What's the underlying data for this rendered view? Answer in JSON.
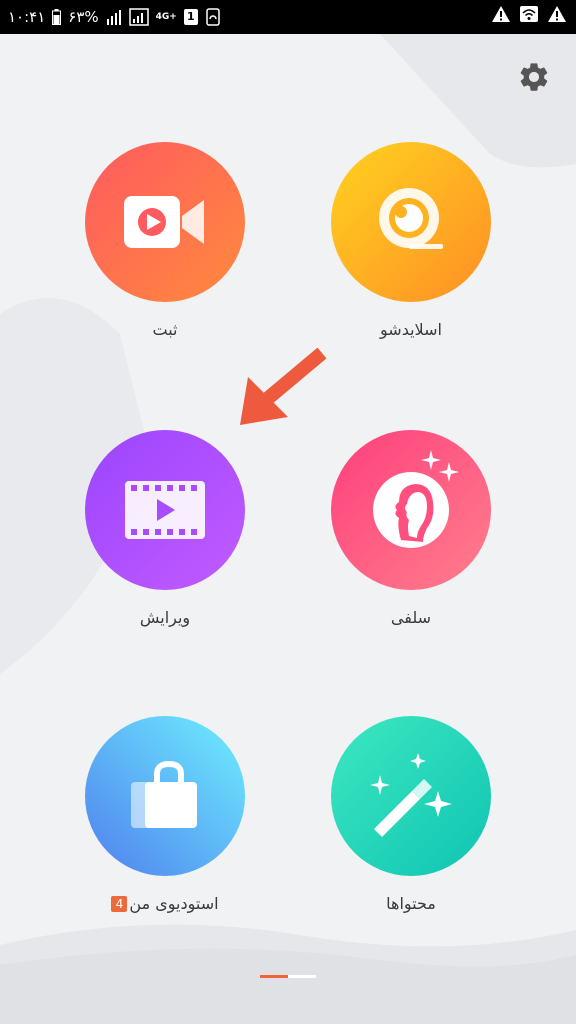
{
  "status_bar": {
    "time": "۱۰:۴۱",
    "battery": "۶۳%",
    "network": "4G+",
    "sim_slot": "1"
  },
  "tiles": [
    {
      "id": "record",
      "label": "ثبت",
      "icon": "video-camera-icon",
      "gradient": [
        "#ff5a5f",
        "#ff8a3d"
      ]
    },
    {
      "id": "slideshow",
      "label": "اسلایدشو",
      "icon": "webcam-icon",
      "gradient": [
        "#ffd21f",
        "#ff8f26"
      ]
    },
    {
      "id": "edit",
      "label": "ویرایش",
      "icon": "film-play-icon",
      "gradient": [
        "#9b45ff",
        "#c25bff"
      ]
    },
    {
      "id": "selfie",
      "label": "سلفی",
      "icon": "face-profile-icon",
      "gradient": [
        "#ff3f7d",
        "#ff7f8c"
      ]
    },
    {
      "id": "studio",
      "label": "استودیوی من",
      "badge": "4",
      "icon": "shopping-bag-icon",
      "gradient": [
        "#6ef0ff",
        "#4f7fee"
      ]
    },
    {
      "id": "content",
      "label": "محتواها",
      "icon": "magic-wand-icon",
      "gradient": [
        "#3ee8c0",
        "#0ec4b3"
      ]
    }
  ],
  "colors": {
    "arrow": "#ee5a3e",
    "page_indicator_active": "#f06536"
  },
  "pager": {
    "pages": 2,
    "current": 1
  }
}
